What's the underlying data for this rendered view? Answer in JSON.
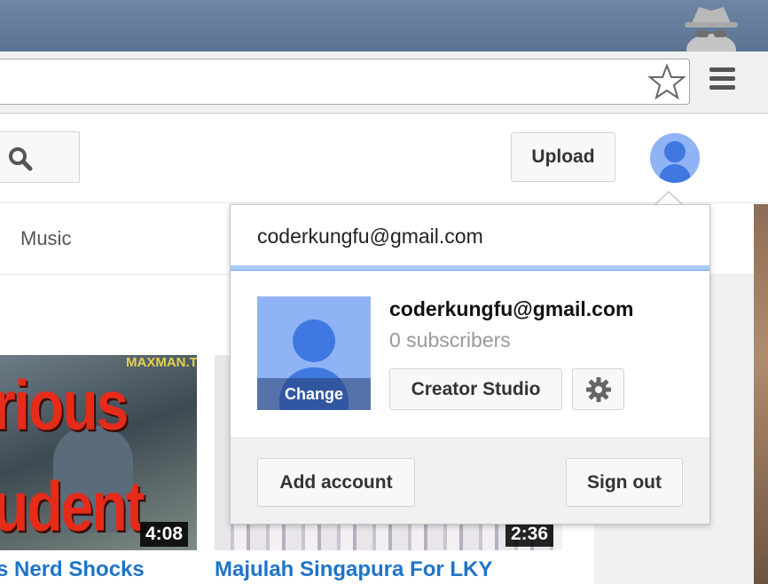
{
  "browser": {
    "icons": {
      "incognito": "incognito-icon",
      "star": "bookmark-star-icon",
      "menu": "hamburger-menu-icon"
    }
  },
  "masthead": {
    "search_icon": "search-icon",
    "upload_label": "Upload",
    "avatar_icon": "account-avatar-icon"
  },
  "nav": {
    "music_label": "Music"
  },
  "videos": [
    {
      "thumb_text_top": "rious",
      "thumb_text_bottom": "udent",
      "brand": "MAXMAN.TV",
      "duration": "4:08",
      "title": "s Nerd Shocks"
    },
    {
      "duration": "2:36",
      "title": "Majulah Singapura For LKY"
    }
  ],
  "account_menu": {
    "header_email": "coderkungfu@gmail.com",
    "channel": {
      "email": "coderkungfu@gmail.com",
      "subscribers": "0 subscribers",
      "change_label": "Change",
      "creator_studio_label": "Creator Studio",
      "settings_icon": "gear-icon"
    },
    "add_account_label": "Add account",
    "sign_out_label": "Sign out"
  },
  "colors": {
    "link_blue": "#1e74c8",
    "avatar_blue": "#3f78e0",
    "avatar_bg": "#8fb3f5",
    "accent_line": "#a9cbf4"
  }
}
